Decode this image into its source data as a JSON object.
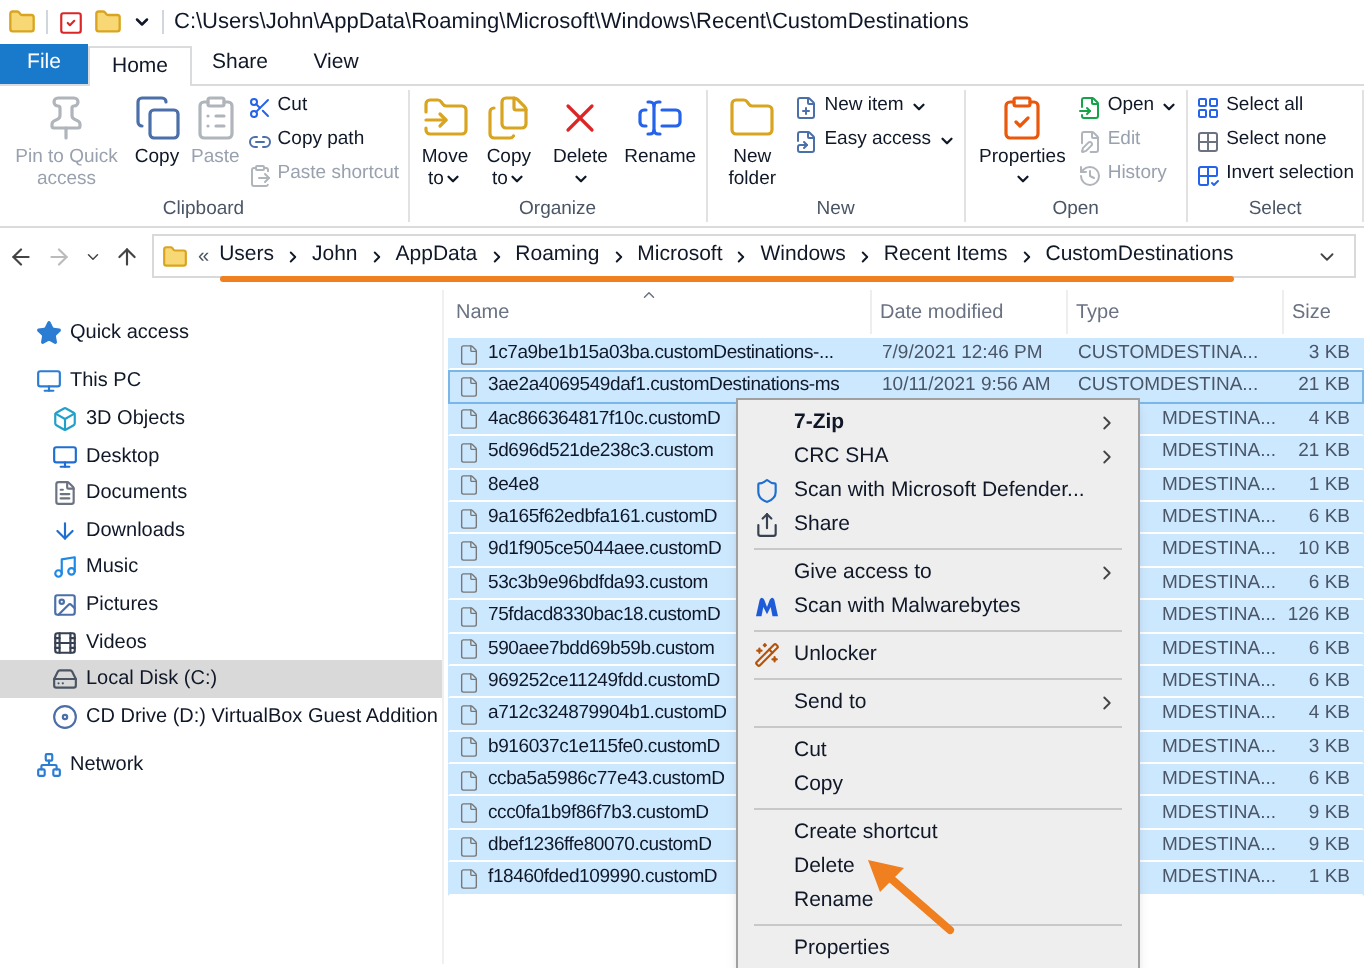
{
  "title_bar": {
    "path": "C:\\Users\\John\\AppData\\Roaming\\Microsoft\\Windows\\Recent\\CustomDestinations"
  },
  "ribbon": {
    "tabs": [
      {
        "label": "File",
        "kind": "file",
        "selected": false
      },
      {
        "label": "Home",
        "kind": "tab",
        "selected": true
      },
      {
        "label": "Share",
        "kind": "tab",
        "selected": false
      },
      {
        "label": "View",
        "kind": "tab",
        "selected": false
      }
    ],
    "groups": [
      {
        "label": "Clipboard",
        "items": [
          {
            "label": "Pin to Quick access",
            "kind": "large",
            "disabled": true,
            "dropdown": false
          },
          {
            "label": "Copy",
            "kind": "large",
            "disabled": false,
            "dropdown": false
          },
          {
            "label": "Paste",
            "kind": "large",
            "disabled": true,
            "dropdown": false
          },
          {
            "label": "Cut",
            "kind": "small",
            "disabled": false,
            "dropdown": false
          },
          {
            "label": "Copy path",
            "kind": "small",
            "disabled": false,
            "dropdown": false
          },
          {
            "label": "Paste shortcut",
            "kind": "small",
            "disabled": true,
            "dropdown": false
          }
        ]
      },
      {
        "label": "Organize",
        "items": [
          {
            "label": "Move to",
            "kind": "large",
            "disabled": false,
            "dropdown": true
          },
          {
            "label": "Copy to",
            "kind": "large",
            "disabled": false,
            "dropdown": true
          },
          {
            "label": "Delete",
            "kind": "large",
            "disabled": false,
            "dropdown": true
          },
          {
            "label": "Rename",
            "kind": "large",
            "disabled": false,
            "dropdown": false
          }
        ]
      },
      {
        "label": "New",
        "items": [
          {
            "label": "New folder",
            "kind": "large",
            "disabled": false,
            "dropdown": false
          },
          {
            "label": "New item",
            "kind": "small",
            "disabled": false,
            "dropdown": true
          },
          {
            "label": "Easy access",
            "kind": "small",
            "disabled": false,
            "dropdown": true
          }
        ]
      },
      {
        "label": "Open",
        "items": [
          {
            "label": "Properties",
            "kind": "large",
            "disabled": false,
            "dropdown": true
          },
          {
            "label": "Open",
            "kind": "small",
            "disabled": false,
            "dropdown": true
          },
          {
            "label": "Edit",
            "kind": "small",
            "disabled": true,
            "dropdown": false
          },
          {
            "label": "History",
            "kind": "small",
            "disabled": true,
            "dropdown": false
          }
        ]
      },
      {
        "label": "Select",
        "items": [
          {
            "label": "Select all",
            "kind": "small",
            "disabled": false,
            "dropdown": false
          },
          {
            "label": "Select none",
            "kind": "small",
            "disabled": false,
            "dropdown": false
          },
          {
            "label": "Invert selection",
            "kind": "small",
            "disabled": false,
            "dropdown": false
          }
        ]
      }
    ]
  },
  "address_bar": {
    "overflow": "«",
    "crumbs": [
      "Users",
      "John",
      "AppData",
      "Roaming",
      "Microsoft",
      "Windows",
      "Recent Items",
      "CustomDestinations"
    ]
  },
  "sidebar": {
    "items": [
      {
        "label": "Quick access",
        "selected": false
      },
      {
        "label": "This PC",
        "selected": false,
        "children": [
          {
            "label": "3D Objects",
            "selected": false
          },
          {
            "label": "Desktop",
            "selected": false
          },
          {
            "label": "Documents",
            "selected": false
          },
          {
            "label": "Downloads",
            "selected": false
          },
          {
            "label": "Music",
            "selected": false
          },
          {
            "label": "Pictures",
            "selected": false
          },
          {
            "label": "Videos",
            "selected": false
          },
          {
            "label": "Local Disk (C:)",
            "selected": true
          },
          {
            "label": "CD Drive (D:) VirtualBox Guest Addition",
            "selected": false
          }
        ]
      },
      {
        "label": "Network",
        "selected": false
      }
    ]
  },
  "file_list": {
    "columns": [
      "Name",
      "Date modified",
      "Type",
      "Size"
    ],
    "rows": [
      {
        "name": "1c7a9be1b15a03ba.customDestinations-...",
        "date": "7/9/2021 12:46 PM",
        "type": "CUSTOMDESTINA...",
        "size": "3 KB",
        "selected": true,
        "focused": false
      },
      {
        "name": "3ae2a4069549daf1.customDestinations-ms",
        "date": "10/11/2021 9:56 AM",
        "type": "CUSTOMDESTINA...",
        "size": "21 KB",
        "selected": true,
        "focused": true
      },
      {
        "name": "4ac866364817f10c.customD",
        "type": "MDESTINA...",
        "size": "4 KB",
        "selected": true,
        "focused": false
      },
      {
        "name": "5d696d521de238c3.custom",
        "type": "MDESTINA...",
        "size": "21 KB",
        "selected": true,
        "focused": false
      },
      {
        "name": "8e4e8",
        "type": "MDESTINA...",
        "size": "1 KB",
        "selected": true,
        "focused": false
      },
      {
        "name": "9a165f62edbfa161.customD",
        "type": "MDESTINA...",
        "size": "6 KB",
        "selected": true,
        "focused": false
      },
      {
        "name": "9d1f905ce5044aee.customD",
        "type": "MDESTINA...",
        "size": "10 KB",
        "selected": true,
        "focused": false
      },
      {
        "name": "53c3b9e96bdfda93.custom",
        "type": "MDESTINA...",
        "size": "6 KB",
        "selected": true,
        "focused": false
      },
      {
        "name": "75fdacd8330bac18.customD",
        "type": "MDESTINA...",
        "size": "126 KB",
        "selected": true,
        "focused": false
      },
      {
        "name": "590aee7bdd69b59b.custom",
        "type": "MDESTINA...",
        "size": "6 KB",
        "selected": true,
        "focused": false
      },
      {
        "name": "969252ce11249fdd.customD",
        "type": "MDESTINA...",
        "size": "6 KB",
        "selected": true,
        "focused": false
      },
      {
        "name": "a712c324879904b1.customD",
        "type": "MDESTINA...",
        "size": "4 KB",
        "selected": true,
        "focused": false
      },
      {
        "name": "b916037c1e115fe0.customD",
        "type": "MDESTINA...",
        "size": "3 KB",
        "selected": true,
        "focused": false
      },
      {
        "name": "ccba5a5986c77e43.customD",
        "type": "MDESTINA...",
        "size": "6 KB",
        "selected": true,
        "focused": false
      },
      {
        "name": "ccc0fa1b9f86f7b3.customD",
        "type": "MDESTINA...",
        "size": "9 KB",
        "selected": true,
        "focused": false
      },
      {
        "name": "dbef1236ffe80070.customD",
        "type": "MDESTINA...",
        "size": "9 KB",
        "selected": true,
        "focused": false
      },
      {
        "name": "f18460fded109990.customD",
        "type": "MDESTINA...",
        "size": "1 KB",
        "selected": true,
        "focused": false
      }
    ]
  },
  "context_menu": {
    "sections": [
      [
        {
          "label": "7-Zip",
          "bold": true,
          "submenu": true
        },
        {
          "label": "CRC SHA",
          "bold": false,
          "submenu": true
        },
        {
          "label": "Scan with Microsoft Defender...",
          "bold": false,
          "submenu": false
        },
        {
          "label": "Share",
          "bold": false,
          "submenu": false
        }
      ],
      [
        {
          "label": "Give access to",
          "bold": false,
          "submenu": true
        },
        {
          "label": "Scan with Malwarebytes",
          "bold": false,
          "submenu": false
        }
      ],
      [
        {
          "label": "Unlocker",
          "bold": false,
          "submenu": false
        }
      ],
      [
        {
          "label": "Send to",
          "bold": false,
          "submenu": true
        }
      ],
      [
        {
          "label": "Cut",
          "bold": false,
          "submenu": false
        },
        {
          "label": "Copy",
          "bold": false,
          "submenu": false
        }
      ],
      [
        {
          "label": "Create shortcut",
          "bold": false,
          "submenu": false
        },
        {
          "label": "Delete",
          "bold": false,
          "submenu": false
        },
        {
          "label": "Rename",
          "bold": false,
          "submenu": false
        }
      ],
      [
        {
          "label": "Properties",
          "bold": false,
          "submenu": false
        }
      ]
    ]
  }
}
